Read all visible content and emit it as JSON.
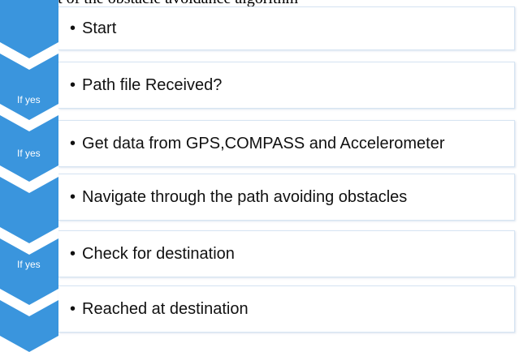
{
  "top_caption": "flowchart of the obstacle avoidance algorithm",
  "accent_color": "#3a95dd",
  "bullet_glyph": "•",
  "steps": [
    {
      "condition_label": "",
      "text": "Start"
    },
    {
      "condition_label": "If yes",
      "text": "Path file Received?"
    },
    {
      "condition_label": "If yes",
      "text": "Get data from GPS,COMPASS and Accelerometer"
    },
    {
      "condition_label": "",
      "text": "Navigate through the path avoiding obstacles"
    },
    {
      "condition_label": "If yes",
      "text": "Check for destination"
    },
    {
      "condition_label": "",
      "text": "Reached at destination"
    }
  ]
}
